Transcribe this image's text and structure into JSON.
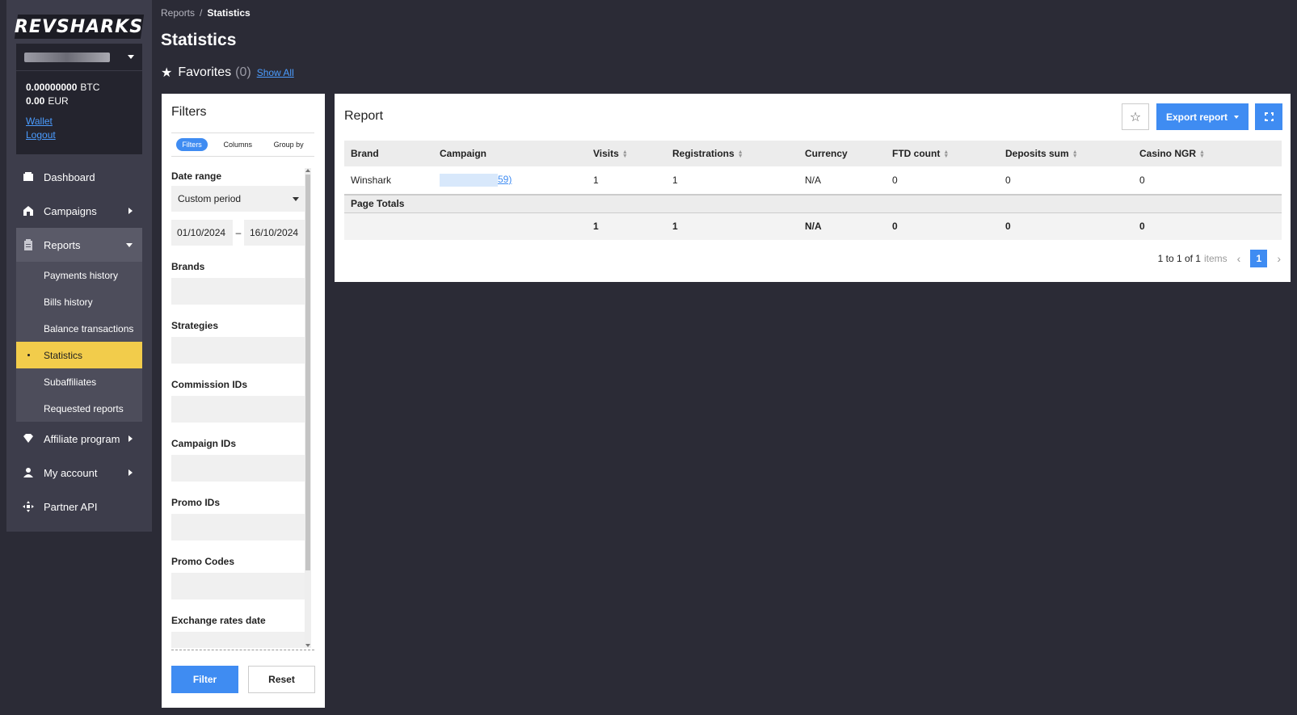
{
  "brand": {
    "logo_text": "REVSHARKS"
  },
  "account": {
    "btc_amount": "0.00000000",
    "btc_currency": "BTC",
    "eur_amount": "0.00",
    "eur_currency": "EUR",
    "wallet_link": "Wallet",
    "logout_link": "Logout"
  },
  "nav": {
    "dashboard": "Dashboard",
    "campaigns": "Campaigns",
    "reports": "Reports",
    "report_items": [
      "Payments history",
      "Bills history",
      "Balance transactions",
      "Statistics",
      "Subaffiliates",
      "Requested reports"
    ],
    "affiliate_program": "Affiliate program",
    "my_account": "My account",
    "partner_api": "Partner API"
  },
  "header": {
    "breadcrumb_parent": "Reports",
    "breadcrumb_sep": "/",
    "breadcrumb_current": "Statistics",
    "title": "Statistics",
    "favorites_label": "Favorites",
    "favorites_count": "(0)",
    "show_all": "Show All"
  },
  "filters": {
    "title": "Filters",
    "tabs": [
      "Filters",
      "Columns",
      "Group by"
    ],
    "date_range_label": "Date range",
    "period_value": "Custom period",
    "date_from": "01/10/2024",
    "date_sep": "–",
    "date_to": "16/10/2024",
    "fields": [
      "Brands",
      "Strategies",
      "Commission IDs",
      "Campaign IDs",
      "Promo IDs",
      "Promo Codes",
      "Exchange rates date"
    ],
    "filter_button": "Filter",
    "reset_button": "Reset"
  },
  "report": {
    "title": "Report",
    "export_button": "Export report",
    "columns": [
      "Brand",
      "Campaign",
      "Visits",
      "Registrations",
      "Currency",
      "FTD count",
      "Deposits sum",
      "Casino NGR"
    ],
    "rows": [
      {
        "brand": "Winshark",
        "campaign": "59)",
        "visits": "1",
        "registrations": "1",
        "currency": "N/A",
        "ftd_count": "0",
        "deposits_sum": "0",
        "casino_ngr": "0"
      }
    ],
    "totals_label": "Page Totals",
    "totals": {
      "visits": "1",
      "registrations": "1",
      "currency": "N/A",
      "ftd_count": "0",
      "deposits_sum": "0",
      "casino_ngr": "0"
    },
    "pagination": {
      "summary": "1 to 1 of 1",
      "items_word": "items",
      "current_page": "1"
    }
  },
  "colors": {
    "accent": "#3f8cf2",
    "active_nav": "#f2cc4b",
    "background": "#2b2b36",
    "sidebar": "#3d3d4b"
  }
}
